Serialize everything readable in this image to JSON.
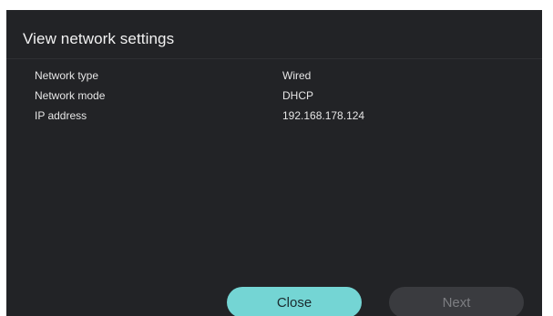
{
  "dialog": {
    "title": "View network settings"
  },
  "settings": [
    {
      "label": "Network type",
      "value": "Wired"
    },
    {
      "label": "Network mode",
      "value": "DHCP"
    },
    {
      "label": "IP address",
      "value": "192.168.178.124"
    }
  ],
  "buttons": {
    "close_label": "Close",
    "next_label": "Next"
  },
  "colors": {
    "background": "#222326",
    "accent": "#74d5d4",
    "disabled_button": "#3a3b3f",
    "text": "#e6e6e6"
  }
}
